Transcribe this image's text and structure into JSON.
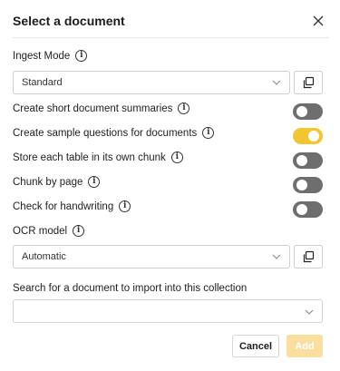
{
  "dialog": {
    "title": "Select a document",
    "close_icon": "close-icon"
  },
  "ingest_mode": {
    "label": "Ingest Mode",
    "value": "Standard",
    "copy_icon": "copy-icon"
  },
  "options": [
    {
      "label": "Create short document summaries",
      "enabled": false
    },
    {
      "label": "Create sample questions for documents",
      "enabled": true
    },
    {
      "label": "Store each table in its own chunk",
      "enabled": false
    },
    {
      "label": "Chunk by page",
      "enabled": false
    },
    {
      "label": "Check for handwriting",
      "enabled": false
    }
  ],
  "ocr_model": {
    "label": "OCR model",
    "value": "Automatic",
    "copy_icon": "copy-icon"
  },
  "search": {
    "label": "Search for a document to import into this collection",
    "value": ""
  },
  "buttons": {
    "cancel": "Cancel",
    "add": "Add"
  },
  "colors": {
    "toggle_on": "#f2c531",
    "toggle_off": "#6e6e6e",
    "add_disabled": "#f9df9d"
  }
}
